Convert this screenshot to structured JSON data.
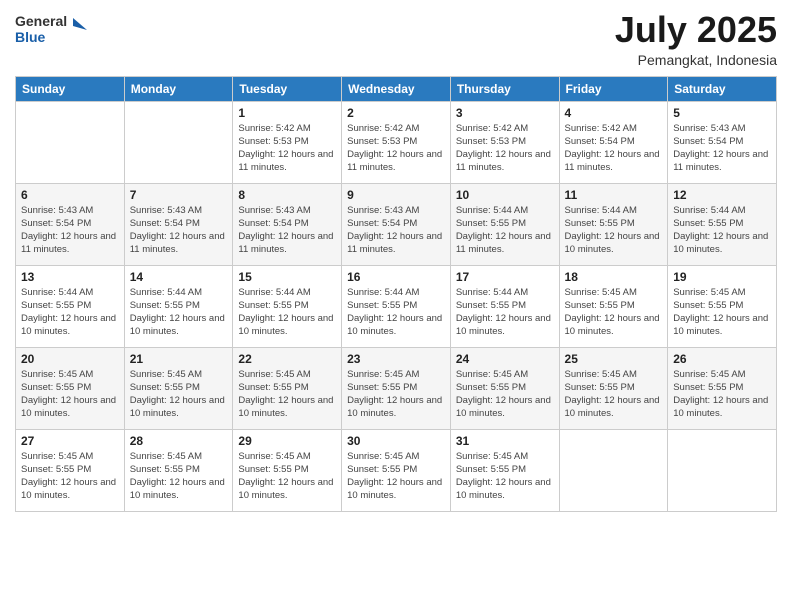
{
  "header": {
    "logo_general": "General",
    "logo_blue": "Blue",
    "month_year": "July 2025",
    "location": "Pemangkat, Indonesia"
  },
  "days_of_week": [
    "Sunday",
    "Monday",
    "Tuesday",
    "Wednesday",
    "Thursday",
    "Friday",
    "Saturday"
  ],
  "weeks": [
    [
      {
        "day": "",
        "info": ""
      },
      {
        "day": "",
        "info": ""
      },
      {
        "day": "1",
        "info": "Sunrise: 5:42 AM\nSunset: 5:53 PM\nDaylight: 12 hours and 11 minutes."
      },
      {
        "day": "2",
        "info": "Sunrise: 5:42 AM\nSunset: 5:53 PM\nDaylight: 12 hours and 11 minutes."
      },
      {
        "day": "3",
        "info": "Sunrise: 5:42 AM\nSunset: 5:53 PM\nDaylight: 12 hours and 11 minutes."
      },
      {
        "day": "4",
        "info": "Sunrise: 5:42 AM\nSunset: 5:54 PM\nDaylight: 12 hours and 11 minutes."
      },
      {
        "day": "5",
        "info": "Sunrise: 5:43 AM\nSunset: 5:54 PM\nDaylight: 12 hours and 11 minutes."
      }
    ],
    [
      {
        "day": "6",
        "info": "Sunrise: 5:43 AM\nSunset: 5:54 PM\nDaylight: 12 hours and 11 minutes."
      },
      {
        "day": "7",
        "info": "Sunrise: 5:43 AM\nSunset: 5:54 PM\nDaylight: 12 hours and 11 minutes."
      },
      {
        "day": "8",
        "info": "Sunrise: 5:43 AM\nSunset: 5:54 PM\nDaylight: 12 hours and 11 minutes."
      },
      {
        "day": "9",
        "info": "Sunrise: 5:43 AM\nSunset: 5:54 PM\nDaylight: 12 hours and 11 minutes."
      },
      {
        "day": "10",
        "info": "Sunrise: 5:44 AM\nSunset: 5:55 PM\nDaylight: 12 hours and 11 minutes."
      },
      {
        "day": "11",
        "info": "Sunrise: 5:44 AM\nSunset: 5:55 PM\nDaylight: 12 hours and 10 minutes."
      },
      {
        "day": "12",
        "info": "Sunrise: 5:44 AM\nSunset: 5:55 PM\nDaylight: 12 hours and 10 minutes."
      }
    ],
    [
      {
        "day": "13",
        "info": "Sunrise: 5:44 AM\nSunset: 5:55 PM\nDaylight: 12 hours and 10 minutes."
      },
      {
        "day": "14",
        "info": "Sunrise: 5:44 AM\nSunset: 5:55 PM\nDaylight: 12 hours and 10 minutes."
      },
      {
        "day": "15",
        "info": "Sunrise: 5:44 AM\nSunset: 5:55 PM\nDaylight: 12 hours and 10 minutes."
      },
      {
        "day": "16",
        "info": "Sunrise: 5:44 AM\nSunset: 5:55 PM\nDaylight: 12 hours and 10 minutes."
      },
      {
        "day": "17",
        "info": "Sunrise: 5:44 AM\nSunset: 5:55 PM\nDaylight: 12 hours and 10 minutes."
      },
      {
        "day": "18",
        "info": "Sunrise: 5:45 AM\nSunset: 5:55 PM\nDaylight: 12 hours and 10 minutes."
      },
      {
        "day": "19",
        "info": "Sunrise: 5:45 AM\nSunset: 5:55 PM\nDaylight: 12 hours and 10 minutes."
      }
    ],
    [
      {
        "day": "20",
        "info": "Sunrise: 5:45 AM\nSunset: 5:55 PM\nDaylight: 12 hours and 10 minutes."
      },
      {
        "day": "21",
        "info": "Sunrise: 5:45 AM\nSunset: 5:55 PM\nDaylight: 12 hours and 10 minutes."
      },
      {
        "day": "22",
        "info": "Sunrise: 5:45 AM\nSunset: 5:55 PM\nDaylight: 12 hours and 10 minutes."
      },
      {
        "day": "23",
        "info": "Sunrise: 5:45 AM\nSunset: 5:55 PM\nDaylight: 12 hours and 10 minutes."
      },
      {
        "day": "24",
        "info": "Sunrise: 5:45 AM\nSunset: 5:55 PM\nDaylight: 12 hours and 10 minutes."
      },
      {
        "day": "25",
        "info": "Sunrise: 5:45 AM\nSunset: 5:55 PM\nDaylight: 12 hours and 10 minutes."
      },
      {
        "day": "26",
        "info": "Sunrise: 5:45 AM\nSunset: 5:55 PM\nDaylight: 12 hours and 10 minutes."
      }
    ],
    [
      {
        "day": "27",
        "info": "Sunrise: 5:45 AM\nSunset: 5:55 PM\nDaylight: 12 hours and 10 minutes."
      },
      {
        "day": "28",
        "info": "Sunrise: 5:45 AM\nSunset: 5:55 PM\nDaylight: 12 hours and 10 minutes."
      },
      {
        "day": "29",
        "info": "Sunrise: 5:45 AM\nSunset: 5:55 PM\nDaylight: 12 hours and 10 minutes."
      },
      {
        "day": "30",
        "info": "Sunrise: 5:45 AM\nSunset: 5:55 PM\nDaylight: 12 hours and 10 minutes."
      },
      {
        "day": "31",
        "info": "Sunrise: 5:45 AM\nSunset: 5:55 PM\nDaylight: 12 hours and 10 minutes."
      },
      {
        "day": "",
        "info": ""
      },
      {
        "day": "",
        "info": ""
      }
    ]
  ]
}
